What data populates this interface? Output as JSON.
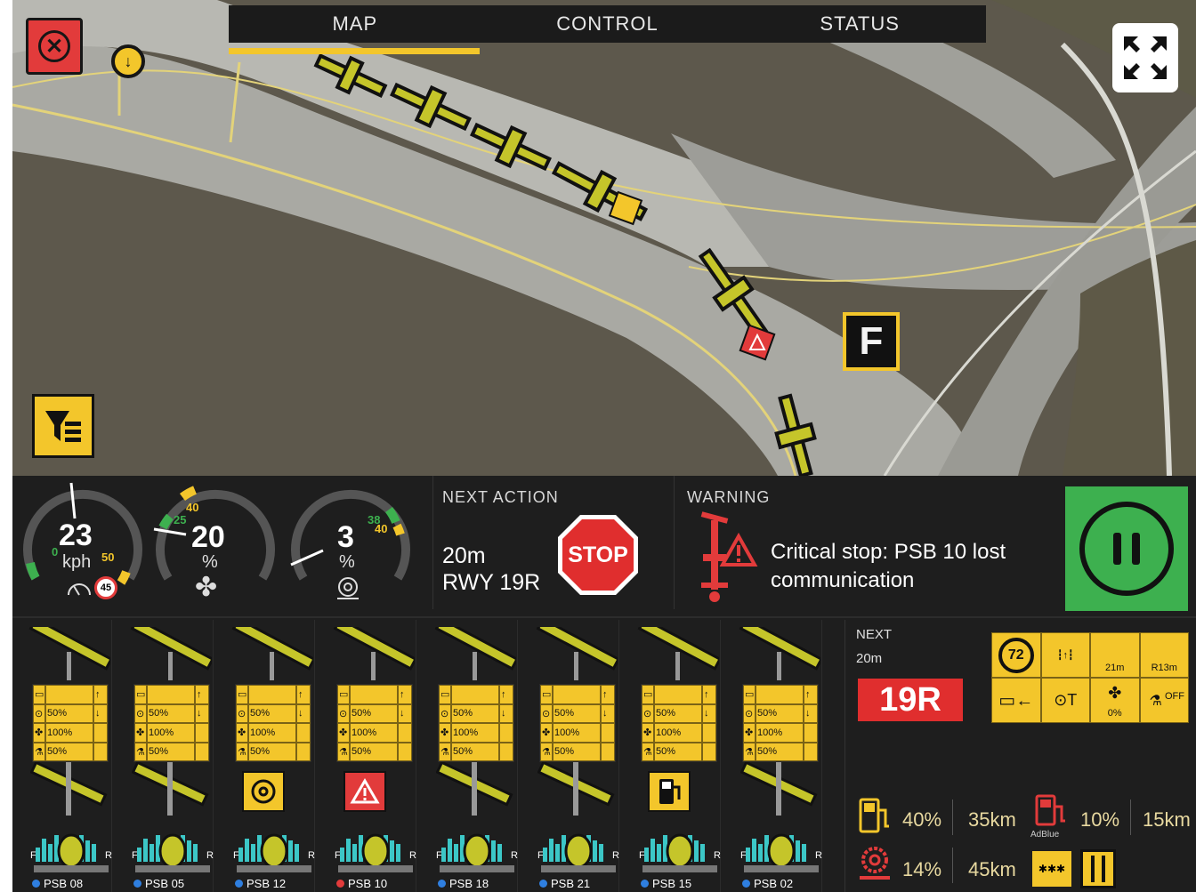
{
  "tabs": [
    {
      "label": "MAP",
      "active": true
    },
    {
      "label": "CONTROL",
      "active": false
    },
    {
      "label": "STATUS",
      "active": false
    }
  ],
  "map": {
    "zone_label": "F",
    "icons": {
      "close": "close-icon",
      "fullscreen": "fullscreen-icon",
      "filter": "filter-icon",
      "user": "location-marker-icon"
    }
  },
  "gauges": {
    "speed": {
      "value": "23",
      "unit": "kph",
      "min_label": "0",
      "max_label": "50",
      "limit_label": "45",
      "value_num": 23,
      "max": 50
    },
    "fan": {
      "value": "20",
      "unit": "%",
      "low_label": "25",
      "high_label": "40",
      "value_num": 20
    },
    "brush": {
      "value": "3",
      "unit": "%",
      "low_label": "38",
      "high_label": "40",
      "value_num": 3
    }
  },
  "next_action": {
    "title": "NEXT ACTION",
    "distance": "20m",
    "runway": "RWY 19R",
    "sign": "STOP"
  },
  "warning": {
    "title": "WARNING",
    "message": "Critical stop: PSB 10 lost communication"
  },
  "pause_button": {
    "icon": "pause-icon"
  },
  "units": [
    {
      "label": "PSB 08",
      "status": "ok",
      "alert": null,
      "rows": [
        "",
        "50%",
        "100%",
        "50%"
      ]
    },
    {
      "label": "PSB 05",
      "status": "ok",
      "alert": null,
      "rows": [
        "",
        "50%",
        "100%",
        "50%"
      ]
    },
    {
      "label": "PSB 12",
      "status": "ok",
      "alert": "brush",
      "rows": [
        "",
        "50%",
        "100%",
        "50%"
      ]
    },
    {
      "label": "PSB 10",
      "status": "error",
      "alert": "warning",
      "rows": [
        "",
        "50%",
        "100%",
        "50%"
      ]
    },
    {
      "label": "PSB 18",
      "status": "ok",
      "alert": null,
      "rows": [
        "",
        "50%",
        "100%",
        "50%"
      ]
    },
    {
      "label": "PSB 21",
      "status": "ok",
      "alert": null,
      "rows": [
        "",
        "50%",
        "100%",
        "50%"
      ]
    },
    {
      "label": "PSB 15",
      "status": "ok",
      "alert": "fuel",
      "rows": [
        "",
        "50%",
        "100%",
        "50%"
      ]
    },
    {
      "label": "PSB 02",
      "status": "ok",
      "alert": null,
      "rows": [
        "",
        "50%",
        "100%",
        "50%"
      ]
    }
  ],
  "battery_labels": {
    "front": "F",
    "rear": "R"
  },
  "next_panel": {
    "title": "NEXT",
    "distance": "20m",
    "runway": "19R",
    "speed_limit": "72",
    "cells": [
      "21m",
      "R13m",
      "0%",
      "OFF"
    ]
  },
  "stats": {
    "fuel_pct": "40%",
    "fuel_range": "35km",
    "adblue_pct": "10%",
    "adblue_range": "15km",
    "adblue_label": "AdBlue",
    "brush_pct": "14%",
    "brush_range": "45km"
  },
  "colors": {
    "accent": "#f3c62b",
    "danger": "#e23b3b",
    "ok": "#3db04f",
    "panel": "#1e1e1e"
  }
}
